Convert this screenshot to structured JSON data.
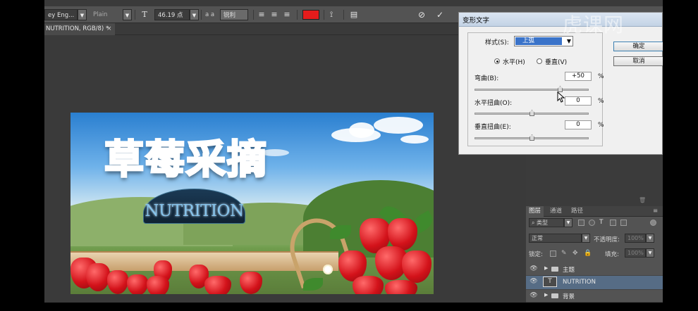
{
  "options_bar": {
    "font_family": "ey Eng...",
    "font_style": "Plain",
    "font_size": "46.19 点",
    "aa_label": "a a",
    "antialias": "锐利",
    "text_color": "#e51c1c"
  },
  "document_tab": {
    "title": "NUTRITION, RGB/8) *",
    "close": "×"
  },
  "artwork": {
    "headline": "草莓采摘",
    "nutrition_text": "NUTRITION"
  },
  "warp_dialog": {
    "title": "变形文字",
    "style_label": "样式(S):",
    "style_value": "上弧",
    "horizontal_label": "水平(H)",
    "vertical_label": "垂直(V)",
    "orientation_selected": "horizontal",
    "bend_label": "弯曲(B):",
    "bend_value": "+50",
    "bend_level": 50,
    "h_distort_label": "水平扭曲(O):",
    "h_distort_value": "0",
    "h_distort_level": 0,
    "v_distort_label": "垂直扭曲(E):",
    "v_distort_value": "0",
    "v_distort_level": 0,
    "percent": "%",
    "ok": "确定",
    "cancel": "取消"
  },
  "layers_panel": {
    "tabs": [
      "图层",
      "通道",
      "路径"
    ],
    "active_tab": "图层",
    "filter_kind": "类型",
    "blend_mode": "正常",
    "opacity_label": "不透明度:",
    "opacity_value": "100%",
    "lock_label": "锁定:",
    "fill_label": "填充:",
    "fill_value": "100%",
    "layers": [
      {
        "name": "主题",
        "kind": "group",
        "selected": false
      },
      {
        "name": "NUTRITION",
        "kind": "text",
        "selected": true
      },
      {
        "name": "背景",
        "kind": "group",
        "selected": false
      }
    ]
  },
  "watermark": "虎课网"
}
